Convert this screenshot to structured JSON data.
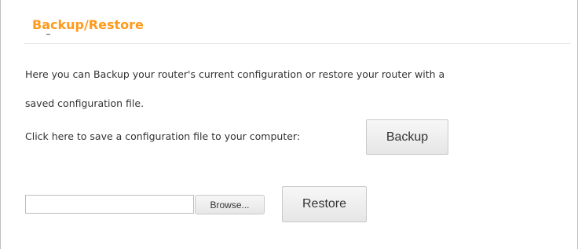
{
  "section": {
    "title": "Backup/Restore"
  },
  "description": {
    "line1": "Here you can Backup your router's current configuration or restore your router with a",
    "line2": "saved configuration file.",
    "save_prompt": "Click here to save a configuration file to your computer:"
  },
  "buttons": {
    "backup_label": "Backup",
    "browse_label": "Browse...",
    "restore_label": "Restore"
  },
  "file_input": {
    "value": "",
    "placeholder": ""
  },
  "colors": {
    "title": "#ff9a1a",
    "text": "#333333",
    "button_border": "#c8c8c8"
  }
}
